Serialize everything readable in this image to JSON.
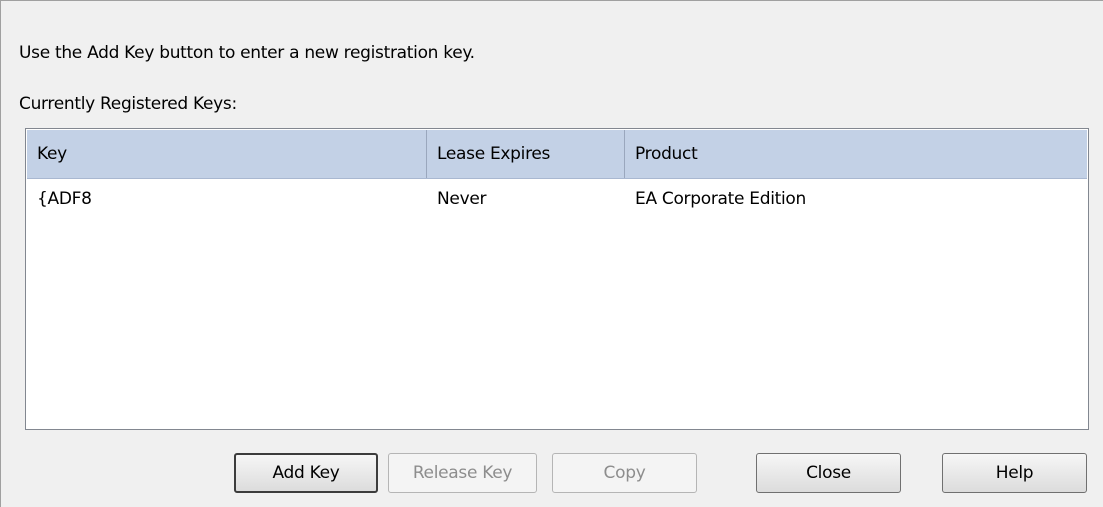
{
  "instruction_text": "Use the Add Key button to enter a new registration key.",
  "group_label": "Currently Registered Keys:",
  "table": {
    "columns": [
      "Key",
      "Lease Expires",
      "Product"
    ],
    "rows": [
      {
        "key": "{ADF8",
        "lease_expires": "Never",
        "product": "EA Corporate Edition"
      }
    ]
  },
  "buttons": {
    "add_key": "Add Key",
    "release_key": "Release Key",
    "copy": "Copy",
    "close": "Close",
    "help": "Help"
  },
  "colors": {
    "dialog_background": "#f0f0f0",
    "header_background": "#c3d1e6",
    "disabled_text": "#8d8d8d"
  }
}
